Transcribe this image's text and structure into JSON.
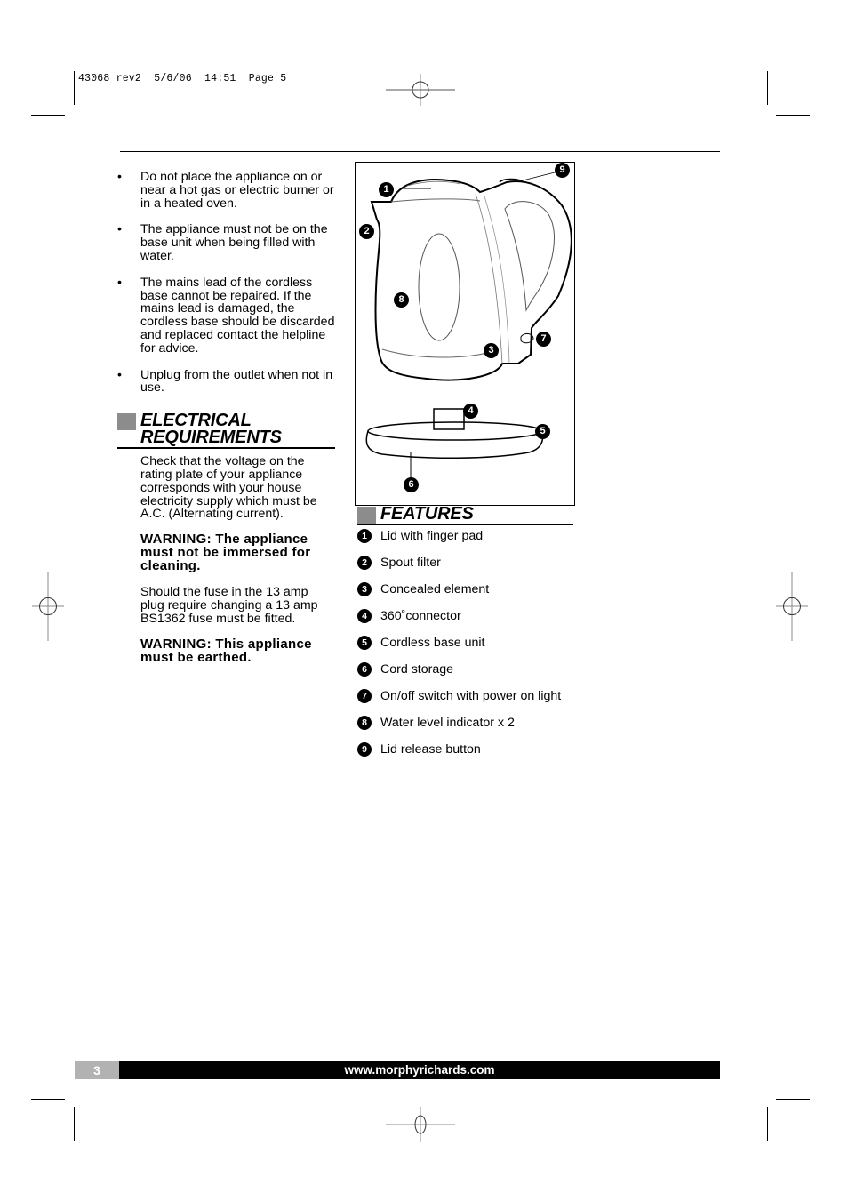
{
  "print_slug": "43068 rev2  5/6/06  14:51  Page 5",
  "left_column": {
    "bullets": [
      "Do not place the appliance on or near a hot gas or electric burner or in a heated oven.",
      "The appliance must not be on the base unit when being filled with water.",
      "The mains lead of the cordless base cannot be repaired. If the mains lead is damaged, the cordless base should be discarded and replaced contact the helpline for advice.",
      "Unplug from the outlet when not in use."
    ],
    "bullet_symbol": "•",
    "electrical": {
      "title_line1": "ELECTRICAL",
      "title_line2": "REQUIREMENTS",
      "para1": "Check that the voltage on the rating plate of your appliance corresponds with your house electricity supply which must be A.C. (Alternating current).",
      "warning1": "WARNING: The appliance must not be immersed for cleaning.",
      "para2": "Should the fuse in the 13 amp plug require changing a 13 amp BS1362 fuse must be fitted.",
      "warning2": "WARNING: This appliance must be earthed."
    }
  },
  "figure": {
    "markers": [
      "1",
      "2",
      "3",
      "4",
      "5",
      "6",
      "7",
      "8",
      "9"
    ]
  },
  "features": {
    "title": "FEATURES",
    "items": [
      {
        "num": "1",
        "label": "Lid with finger pad"
      },
      {
        "num": "2",
        "label": "Spout filter"
      },
      {
        "num": "3",
        "label": "Concealed element"
      },
      {
        "num": "4",
        "label": "360˚connector"
      },
      {
        "num": "5",
        "label": "Cordless base unit"
      },
      {
        "num": "6",
        "label": "Cord storage"
      },
      {
        "num": "7",
        "label": "On/off switch with power on light"
      },
      {
        "num": "8",
        "label": "Water level indicator x 2"
      },
      {
        "num": "9",
        "label": "Lid release button"
      }
    ]
  },
  "footer": {
    "page_number": "3",
    "website": "www.morphyrichards.com"
  }
}
